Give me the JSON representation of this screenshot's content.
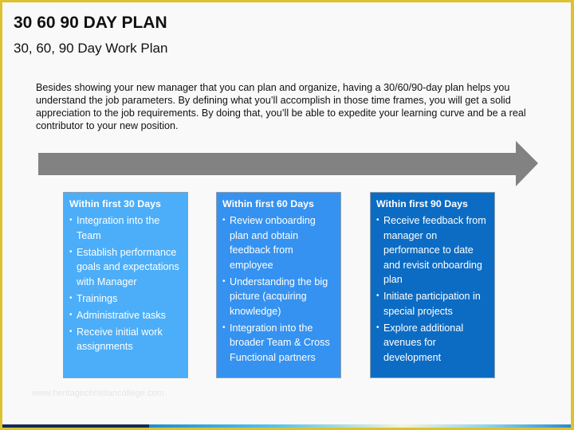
{
  "header": {
    "title": "30 60 90 DAY PLAN",
    "subtitle": "30, 60, 90 Day Work Plan"
  },
  "intro": {
    "text": "Besides showing your new manager that you can plan and organize, having a 30/60/90-day plan helps you understand the job parameters. By defining what you’ll accomplish in those time frames, you will get a solid appreciation to the job requirements. By doing that, you’ll be able to expedite your learning curve and be a real contributor to your new position."
  },
  "timeline_arrow": {
    "icon": "right-arrow-icon",
    "color": "#828282"
  },
  "phases": [
    {
      "heading": "Within first 30 Days",
      "color": "#4caef8",
      "items": [
        "Integration into the Team",
        "Establish performance goals and expectations with Manager",
        "Trainings",
        "Administrative tasks",
        "Receive initial work assignments"
      ]
    },
    {
      "heading": "Within first 60 Days",
      "color": "#3592f0",
      "items": [
        "Review onboarding plan and obtain feedback from employee",
        "Understanding the big picture (acquiring knowledge)",
        "Integration into the broader Team & Cross Functional partners"
      ]
    },
    {
      "heading": "Within first 90 Days",
      "color": "#0c6cc4",
      "items": [
        "Receive feedback from manager on performance to date and revisit onboarding plan",
        "Initiate participation in special projects",
        "Explore additional avenues for development"
      ]
    }
  ],
  "bullet_glyph": "•",
  "watermark": "www.heritagechristiancollege.com",
  "theme": {
    "frame_color": "#ddc12e",
    "footer_navy": "#132a55",
    "footer_blue": "#1f8fc8"
  }
}
